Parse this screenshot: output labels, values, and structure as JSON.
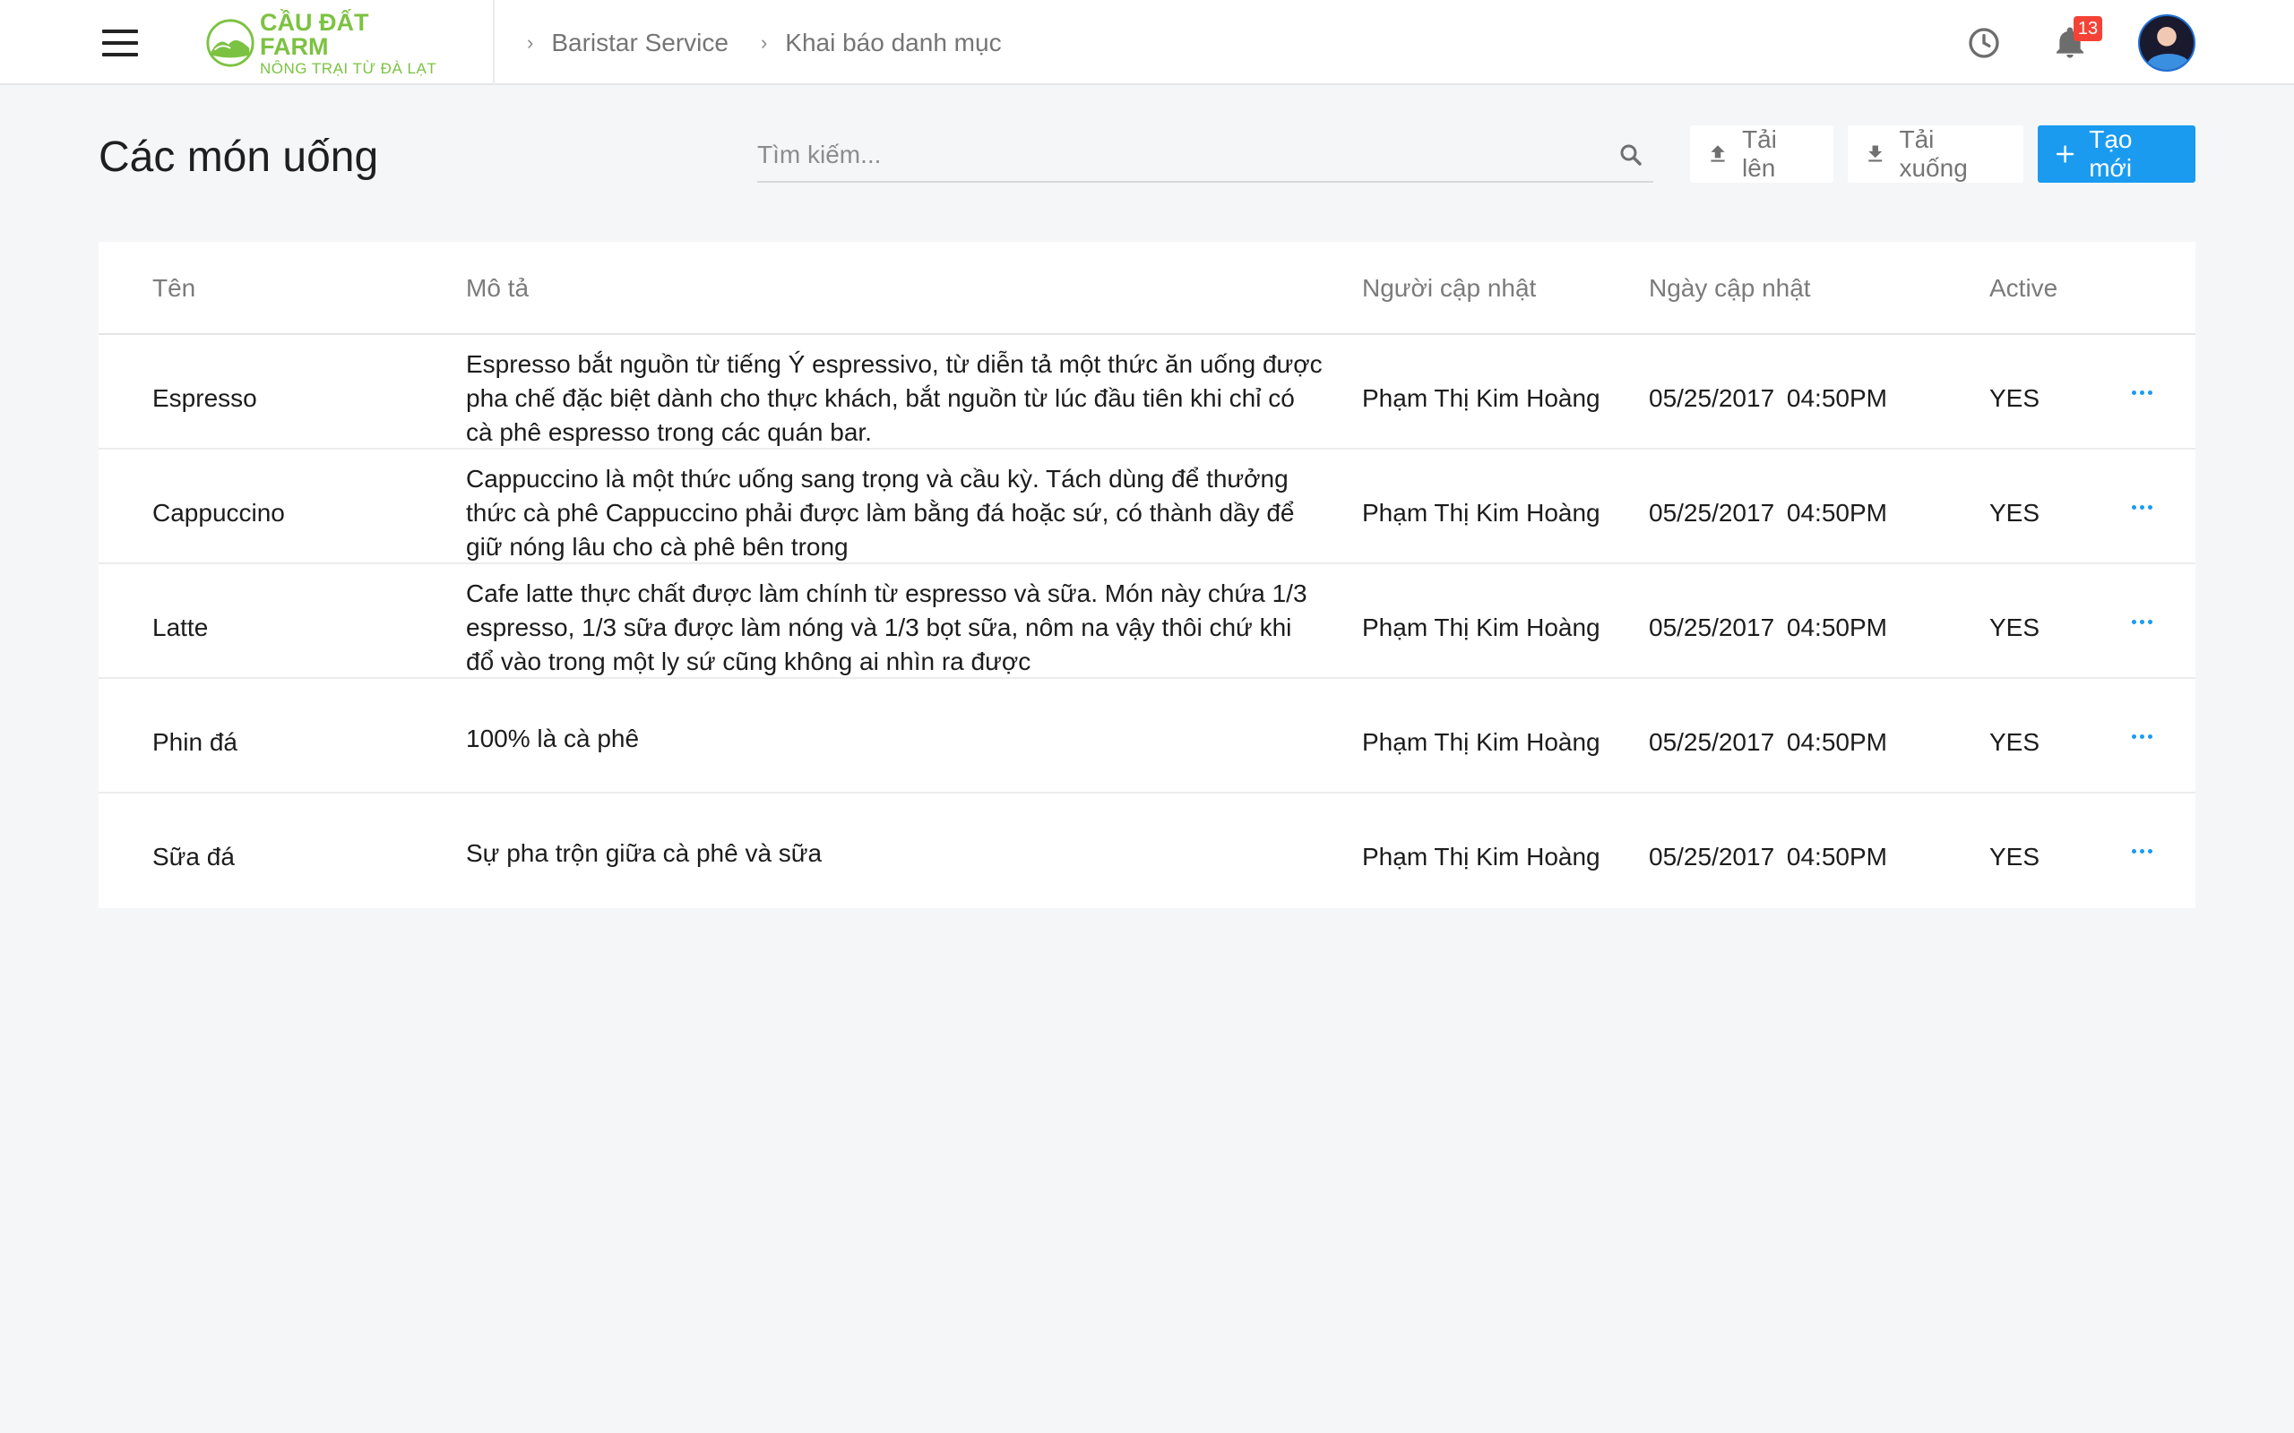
{
  "header": {
    "logo": {
      "title": "CẦU ĐẤT FARM",
      "subtitle": "NÔNG TRẠI TỪ ĐÀ LẠT"
    },
    "breadcrumb": [
      "Baristar Service",
      "Khai báo danh mục"
    ],
    "notification_count": "13"
  },
  "toolbar": {
    "page_title": "Các món uống",
    "search_placeholder": "Tìm kiếm...",
    "upload_label": "Tải lên",
    "download_label": "Tải xuống",
    "create_label": "Tạo mới"
  },
  "colors": {
    "accent": "#1a9bf0",
    "brand_green": "#7cc242",
    "badge": "#f44336"
  },
  "table": {
    "headers": [
      "Tên",
      "Mô tả",
      "Người cập nhật",
      "Ngày cập nhật",
      "Active"
    ],
    "rows": [
      {
        "name": "Espresso",
        "description": "Espresso bắt nguồn từ tiếng Ý espressivo, từ diễn tả một thức ăn uống được pha chế đặc biệt dành cho thực khách, bắt nguồn từ lúc đầu tiên khi chỉ có cà phê espresso trong các quán bar.",
        "updated_by": "Phạm Thị Kim Hoàng",
        "updated_at": "05/25/2017 04:50PM",
        "active": "YES"
      },
      {
        "name": "Cappuccino",
        "description": "Cappuccino là một thức uống sang trọng và cầu kỳ. Tách dùng để thưởng thức cà phê Cappuccino phải được làm bằng đá hoặc sứ, có thành dầy để giữ nóng lâu cho cà phê bên trong",
        "updated_by": "Phạm Thị Kim Hoàng",
        "updated_at": "05/25/2017 04:50PM",
        "active": "YES"
      },
      {
        "name": "Latte",
        "description": "Cafe latte thực chất được làm chính từ espresso và sữa. Món này chứa 1/3 espresso, 1/3 sữa được làm nóng và 1/3 bọt sữa, nôm na vậy thôi chứ khi đổ vào trong một ly sứ cũng không ai nhìn ra được",
        "updated_by": "Phạm Thị Kim Hoàng",
        "updated_at": "05/25/2017 04:50PM",
        "active": "YES"
      },
      {
        "name": "Phin đá",
        "description": "100% là cà phê",
        "updated_by": "Phạm Thị Kim Hoàng",
        "updated_at": "05/25/2017 04:50PM",
        "active": "YES"
      },
      {
        "name": "Sữa đá",
        "description": "Sự pha trộn giữa cà phê và sữa",
        "updated_by": "Phạm Thị Kim Hoàng",
        "updated_at": "05/25/2017 04:50PM",
        "active": "YES"
      }
    ]
  },
  "icons": {
    "menu": "hamburger-icon",
    "history": "clock-icon",
    "notifications": "bell-icon",
    "search": "search-icon",
    "upload": "upload-icon",
    "download": "download-icon",
    "create": "plus-icon",
    "row_actions": "more-horizontal-icon"
  }
}
